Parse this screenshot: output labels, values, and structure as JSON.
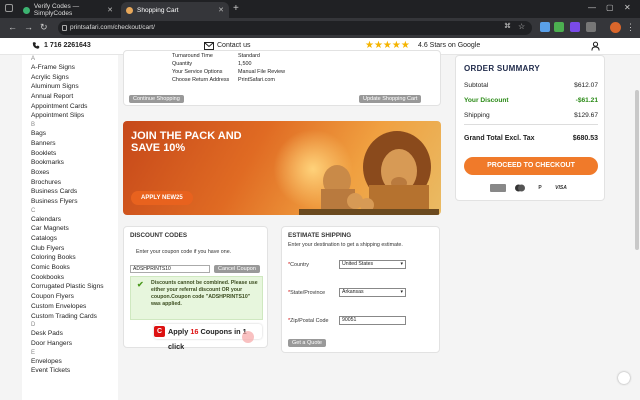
{
  "browser": {
    "tabs": [
      {
        "label": "Verify Codes — SimplyCodes",
        "active": false
      },
      {
        "label": "Shopping Cart",
        "active": true
      }
    ],
    "url": "printsafari.com/checkout/cart/"
  },
  "topbar": {
    "phone": "1 716 2261643",
    "contact": "Contact us",
    "stars_label": "4.6 Stars on Google"
  },
  "sidebar": {
    "groups": [
      {
        "letter": "A",
        "items": [
          "A-Frame Signs",
          "Acrylic Signs",
          "Aluminum Signs",
          "Annual Report",
          "Appointment Cards",
          "Appointment Slips"
        ]
      },
      {
        "letter": "B",
        "items": [
          "Bags",
          "Banners",
          "Booklets",
          "Bookmarks",
          "Boxes",
          "Brochures",
          "Business Cards",
          "Business Flyers"
        ]
      },
      {
        "letter": "C",
        "items": [
          "Calendars",
          "Car Magnets",
          "Catalogs",
          "Club Flyers",
          "Coloring Books",
          "Comic Books",
          "Cookbooks",
          "Corrugated Plastic Signs",
          "Coupon Flyers",
          "Custom Envelopes",
          "Custom Trading Cards"
        ]
      },
      {
        "letter": "D",
        "items": [
          "Desk Pads",
          "Door Hangers"
        ]
      },
      {
        "letter": "E",
        "items": [
          "Envelopes",
          "Event Tickets"
        ]
      }
    ]
  },
  "cart": {
    "details": [
      {
        "label": "Turnaround Time",
        "value": "Standard"
      },
      {
        "label": "Quantity",
        "value": "1,500"
      },
      {
        "label": "Your Service Options",
        "value": "Manual File Review"
      },
      {
        "label": "Choose Return Address",
        "value": "PrintSafari.com"
      }
    ],
    "continue_label": "Continue Shopping",
    "update_label": "Update Shopping Cart"
  },
  "banner": {
    "headline": "JOIN THE PACK AND SAVE 10%",
    "cta": "APPLY NEW25"
  },
  "discount": {
    "title": "DISCOUNT CODES",
    "hint": "Enter your coupon code if you have one.",
    "code_value": "ADSHPRINTS10",
    "cancel_label": "Cancel Coupon",
    "alert": "Discounts cannot be combined. Please use either your referral discount OR your coupon.Coupon code \"ADSHPRINTS10\" was applied.",
    "apply_prefix": "Apply",
    "apply_count": "16",
    "apply_suffix": "Coupons in 1 click"
  },
  "shipping": {
    "title": "ESTIMATE SHIPPING",
    "hint": "Enter your destination to get a shipping estimate.",
    "country_label": "Country",
    "country_value": "United States",
    "state_label": "State/Province",
    "state_value": "Arkansas",
    "zip_label": "Zip/Postal Code",
    "zip_value": "90051",
    "quote_label": "Get a Quote"
  },
  "summary": {
    "title": "ORDER SUMMARY",
    "subtotal_label": "Subtotal",
    "subtotal": "$612.07",
    "discount_label": "Your Discount",
    "discount": "-$61.21",
    "shipping_label": "Shipping",
    "shipping": "$129.67",
    "total_label": "Grand Total Excl. Tax",
    "total": "$680.53",
    "checkout_label": "PROCEED TO CHECKOUT",
    "payment_icons": [
      "amex-icon",
      "mastercard-icon",
      "paypal-icon",
      "visa-icon"
    ],
    "visa_label": "VISA",
    "paypal_label": "P"
  },
  "colors": {
    "accent": "#f07a2a",
    "discount_green": "#2a8a16",
    "alert_bg": "#e7f6dd"
  }
}
